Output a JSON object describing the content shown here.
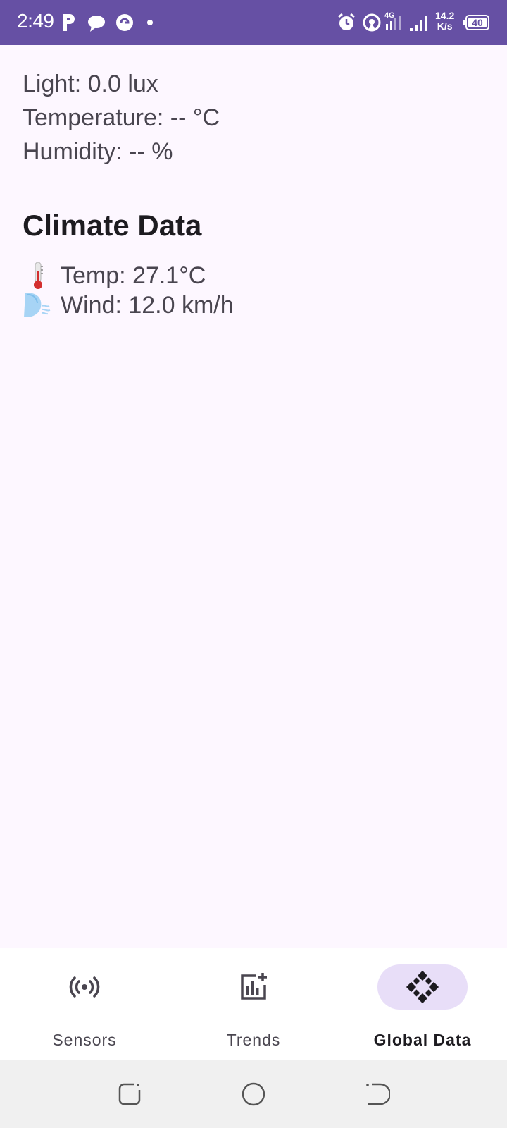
{
  "status_bar": {
    "time": "2:49",
    "speed_value": "14.2",
    "speed_unit": "K/s",
    "battery": "40",
    "network": "4G",
    "bg_color": "#6650a4"
  },
  "sensors": {
    "light": "Light: 0.0 lux",
    "temperature": "Temperature: -- °C",
    "humidity": "Humidity: -- %"
  },
  "climate": {
    "title": "Climate Data",
    "temp": "Temp: 27.1°C",
    "wind": "Wind: 12.0 km/h",
    "temp_icon": "thermometer-icon",
    "wind_icon": "wind-face-icon"
  },
  "bottom_nav": {
    "items": [
      {
        "label": "Sensors",
        "icon": "sensors-icon",
        "active": false
      },
      {
        "label": "Trends",
        "icon": "trends-icon",
        "active": false
      },
      {
        "label": "Global Data",
        "icon": "global-data-icon",
        "active": true
      }
    ],
    "active_pill_color": "#e8def8"
  }
}
